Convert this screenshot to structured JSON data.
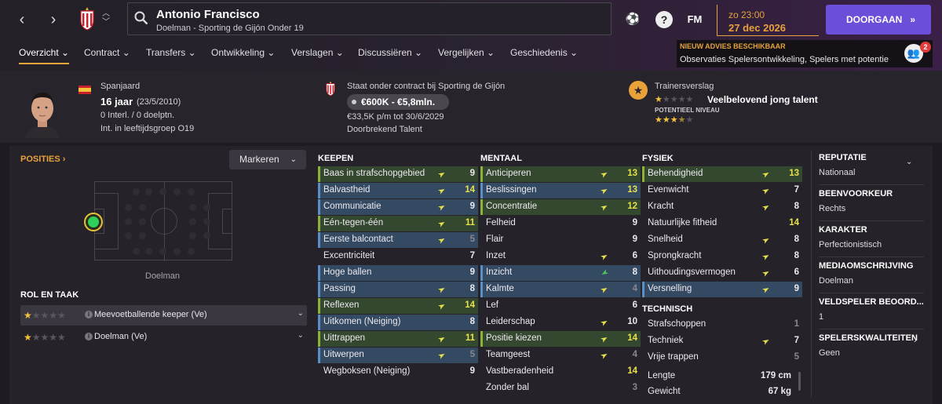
{
  "header": {
    "player_name": "Antonio Francisco",
    "player_subtitle": "Doelman - Sporting de Gijón Onder 19",
    "date_time": "zo 23:00",
    "date_day": "27 dec 2026",
    "continue_label": "DOORGAAN",
    "fm_label": "FM",
    "help_label": "?"
  },
  "tabs": [
    {
      "label": "Overzicht"
    },
    {
      "label": "Contract"
    },
    {
      "label": "Transfers"
    },
    {
      "label": "Ontwikkeling"
    },
    {
      "label": "Verslagen"
    },
    {
      "label": "Discussiëren"
    },
    {
      "label": "Vergelijken"
    },
    {
      "label": "Geschiedenis"
    }
  ],
  "advies": {
    "title": "NIEUW ADVIES BESCHIKBAAR",
    "body": "Observaties Spelersontwikkeling, Spelers met potentie",
    "count": "2"
  },
  "info": {
    "nationality": "Spanjaard",
    "age": "16 jaar",
    "birthdate": "(23/5/2010)",
    "caps": "0 Interl. / 0 doelptn.",
    "youth": "Int. in leeftijdsgroep O19",
    "contract_title": "Staat onder contract bij Sporting de Gijón",
    "value": "€600K - €5,8mln.",
    "wage": "€33,5K p/m tot 30/6/2029",
    "status": "Doorbrekend Talent",
    "coach_title": "Trainersverslag",
    "coach_verdict": "Veelbelovend jong talent",
    "potential_label": "POTENTIEEL NIVEAU",
    "current_stars": 1,
    "potential_stars": 3.5
  },
  "positions": {
    "title": "POSITIES",
    "mark_label": "Markeren",
    "position_label": "Doelman",
    "role_title": "ROL EN TAAK",
    "roles": [
      {
        "name": "Meevoetballende keeper (Ve)",
        "stars": 1
      },
      {
        "name": "Doelman (Ve)",
        "stars": 1
      }
    ]
  },
  "keepen": {
    "title": "KEEPEN",
    "attrs": [
      {
        "name": "Baas in strafschopgebied",
        "value": "9",
        "hl": "g",
        "arrow": "y"
      },
      {
        "name": "Balvastheid",
        "value": "14",
        "hl": "b",
        "arrow": "y"
      },
      {
        "name": "Communicatie",
        "value": "9",
        "hl": "b",
        "arrow": "y"
      },
      {
        "name": "Eén-tegen-één",
        "value": "11",
        "hl": "g",
        "arrow": "y"
      },
      {
        "name": "Eerste balcontact",
        "value": "5",
        "hl": "b",
        "arrow": "y"
      },
      {
        "name": "Excentriciteit",
        "value": "7",
        "hl": "",
        "arrow": ""
      },
      {
        "name": "Hoge ballen",
        "value": "9",
        "hl": "b",
        "arrow": ""
      },
      {
        "name": "Passing",
        "value": "8",
        "hl": "b",
        "arrow": "y"
      },
      {
        "name": "Reflexen",
        "value": "14",
        "hl": "g",
        "arrow": "y"
      },
      {
        "name": "Uitkomen (Neiging)",
        "value": "8",
        "hl": "b",
        "arrow": ""
      },
      {
        "name": "Uittrappen",
        "value": "11",
        "hl": "g",
        "arrow": "y"
      },
      {
        "name": "Uitwerpen",
        "value": "5",
        "hl": "b",
        "arrow": "y"
      },
      {
        "name": "Wegboksen (Neiging)",
        "value": "9",
        "hl": "",
        "arrow": ""
      }
    ]
  },
  "mentaal": {
    "title": "MENTAAL",
    "attrs": [
      {
        "name": "Anticiperen",
        "value": "13",
        "hl": "g",
        "arrow": "y"
      },
      {
        "name": "Beslissingen",
        "value": "13",
        "hl": "b",
        "arrow": "y"
      },
      {
        "name": "Concentratie",
        "value": "12",
        "hl": "g",
        "arrow": "y"
      },
      {
        "name": "Felheid",
        "value": "9",
        "hl": "",
        "arrow": ""
      },
      {
        "name": "Flair",
        "value": "9",
        "hl": "",
        "arrow": ""
      },
      {
        "name": "Inzet",
        "value": "6",
        "hl": "",
        "arrow": "y"
      },
      {
        "name": "Inzicht",
        "value": "8",
        "hl": "b",
        "arrow": "g"
      },
      {
        "name": "Kalmte",
        "value": "4",
        "hl": "b",
        "arrow": "y"
      },
      {
        "name": "Lef",
        "value": "6",
        "hl": "",
        "arrow": ""
      },
      {
        "name": "Leiderschap",
        "value": "10",
        "hl": "",
        "arrow": "y"
      },
      {
        "name": "Positie kiezen",
        "value": "14",
        "hl": "g",
        "arrow": "y"
      },
      {
        "name": "Teamgeest",
        "value": "4",
        "hl": "",
        "arrow": "y"
      },
      {
        "name": "Vastberadenheid",
        "value": "14",
        "hl": "",
        "arrow": ""
      },
      {
        "name": "Zonder bal",
        "value": "3",
        "hl": "",
        "arrow": ""
      }
    ]
  },
  "fysiek": {
    "title": "FYSIEK",
    "attrs": [
      {
        "name": "Behendigheid",
        "value": "13",
        "hl": "g",
        "arrow": "y"
      },
      {
        "name": "Evenwicht",
        "value": "7",
        "hl": "",
        "arrow": "y"
      },
      {
        "name": "Kracht",
        "value": "8",
        "hl": "",
        "arrow": "y"
      },
      {
        "name": "Natuurlijke fitheid",
        "value": "14",
        "hl": "",
        "arrow": ""
      },
      {
        "name": "Snelheid",
        "value": "8",
        "hl": "",
        "arrow": "y"
      },
      {
        "name": "Sprongkracht",
        "value": "8",
        "hl": "",
        "arrow": "y"
      },
      {
        "name": "Uithoudingsvermogen",
        "value": "6",
        "hl": "",
        "arrow": "y"
      },
      {
        "name": "Versnelling",
        "value": "9",
        "hl": "b",
        "arrow": "y"
      }
    ]
  },
  "technisch": {
    "title": "TECHNISCH",
    "attrs": [
      {
        "name": "Strafschoppen",
        "value": "1",
        "hl": "",
        "arrow": ""
      },
      {
        "name": "Techniek",
        "value": "7",
        "hl": "",
        "arrow": "y"
      },
      {
        "name": "Vrije trappen",
        "value": "5",
        "hl": "",
        "arrow": ""
      }
    ],
    "length_label": "Lengte",
    "length_value": "179 cm",
    "weight_label": "Gewicht",
    "weight_value": "67 kg"
  },
  "right_panel": [
    {
      "title": "REPUTATIE",
      "value": "Nationaal"
    },
    {
      "title": "BEENVOORKEUR",
      "value": "Rechts"
    },
    {
      "title": "KARAKTER",
      "value": "Perfectionistisch"
    },
    {
      "title": "MEDIAOMSCHRIJVING",
      "value": "Doelman"
    },
    {
      "title": "VELDSPELER BEOORD...",
      "value": "1"
    },
    {
      "title": "SPELERSKWALITEITEN",
      "value": "Geen"
    }
  ],
  "colors": {
    "accent": "#e8a23a",
    "continue": "#6b4fd8",
    "highlight_yellow": "#e8e14a"
  }
}
